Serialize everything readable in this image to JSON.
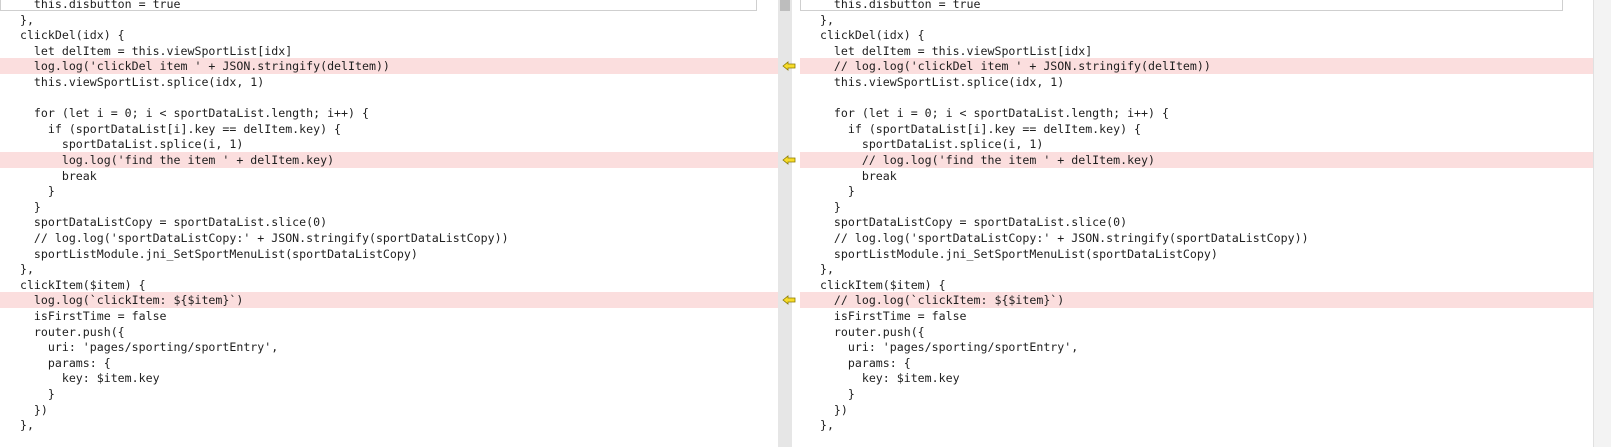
{
  "app": {
    "kind": "side-by-side code diff viewer",
    "colors": {
      "changed_line": "#fbdede",
      "marker": "#f0d000"
    }
  },
  "left": {
    "lines": [
      {
        "text": "    this.disbutton = true",
        "changed": false
      },
      {
        "text": "  },",
        "changed": false
      },
      {
        "text": "  clickDel(idx) {",
        "changed": false
      },
      {
        "text": "    let delItem = this.viewSportList[idx]",
        "changed": false
      },
      {
        "text": "    log.log('clickDel item ' + JSON.stringify(delItem))",
        "changed": true
      },
      {
        "text": "    this.viewSportList.splice(idx, 1)",
        "changed": false
      },
      {
        "text": "",
        "changed": false
      },
      {
        "text": "    for (let i = 0; i < sportDataList.length; i++) {",
        "changed": false
      },
      {
        "text": "      if (sportDataList[i].key == delItem.key) {",
        "changed": false
      },
      {
        "text": "        sportDataList.splice(i, 1)",
        "changed": false
      },
      {
        "text": "        log.log('find the item ' + delItem.key)",
        "changed": true
      },
      {
        "text": "        break",
        "changed": false
      },
      {
        "text": "      }",
        "changed": false
      },
      {
        "text": "    }",
        "changed": false
      },
      {
        "text": "    sportDataListCopy = sportDataList.slice(0)",
        "changed": false
      },
      {
        "text": "    // log.log('sportDataListCopy:' + JSON.stringify(sportDataListCopy))",
        "changed": false
      },
      {
        "text": "    sportListModule.jni_SetSportMenuList(sportDataListCopy)",
        "changed": false
      },
      {
        "text": "  },",
        "changed": false
      },
      {
        "text": "  clickItem($item) {",
        "changed": false
      },
      {
        "text": "    log.log(`clickItem: ${$item}`)",
        "changed": true
      },
      {
        "text": "    isFirstTime = false",
        "changed": false
      },
      {
        "text": "    router.push({",
        "changed": false
      },
      {
        "text": "      uri: 'pages/sporting/sportEntry',",
        "changed": false
      },
      {
        "text": "      params: {",
        "changed": false
      },
      {
        "text": "        key: $item.key",
        "changed": false
      },
      {
        "text": "      }",
        "changed": false
      },
      {
        "text": "    })",
        "changed": false
      },
      {
        "text": "  },",
        "changed": false
      }
    ]
  },
  "right": {
    "lines": [
      {
        "text": "    this.disbutton = true",
        "changed": false
      },
      {
        "text": "  },",
        "changed": false
      },
      {
        "text": "  clickDel(idx) {",
        "changed": false
      },
      {
        "text": "    let delItem = this.viewSportList[idx]",
        "changed": false
      },
      {
        "text": "    // log.log('clickDel item ' + JSON.stringify(delItem))",
        "changed": true
      },
      {
        "text": "    this.viewSportList.splice(idx, 1)",
        "changed": false
      },
      {
        "text": "",
        "changed": false
      },
      {
        "text": "    for (let i = 0; i < sportDataList.length; i++) {",
        "changed": false
      },
      {
        "text": "      if (sportDataList[i].key == delItem.key) {",
        "changed": false
      },
      {
        "text": "        sportDataList.splice(i, 1)",
        "changed": false
      },
      {
        "text": "        // log.log('find the item ' + delItem.key)",
        "changed": true
      },
      {
        "text": "        break",
        "changed": false
      },
      {
        "text": "      }",
        "changed": false
      },
      {
        "text": "    }",
        "changed": false
      },
      {
        "text": "    sportDataListCopy = sportDataList.slice(0)",
        "changed": false
      },
      {
        "text": "    // log.log('sportDataListCopy:' + JSON.stringify(sportDataListCopy))",
        "changed": false
      },
      {
        "text": "    sportListModule.jni_SetSportMenuList(sportDataListCopy)",
        "changed": false
      },
      {
        "text": "  },",
        "changed": false
      },
      {
        "text": "  clickItem($item) {",
        "changed": false
      },
      {
        "text": "    // log.log(`clickItem: ${$item}`)",
        "changed": true
      },
      {
        "text": "    isFirstTime = false",
        "changed": false
      },
      {
        "text": "    router.push({",
        "changed": false
      },
      {
        "text": "      uri: 'pages/sporting/sportEntry',",
        "changed": false
      },
      {
        "text": "      params: {",
        "changed": false
      },
      {
        "text": "        key: $item.key",
        "changed": false
      },
      {
        "text": "      }",
        "changed": false
      },
      {
        "text": "    })",
        "changed": false
      },
      {
        "text": "  },",
        "changed": false
      }
    ]
  },
  "markers": [
    {
      "line": 4,
      "icon": "copy-left-arrow-icon"
    },
    {
      "line": 10,
      "icon": "copy-left-arrow-icon"
    },
    {
      "line": 19,
      "icon": "copy-left-arrow-icon"
    }
  ]
}
